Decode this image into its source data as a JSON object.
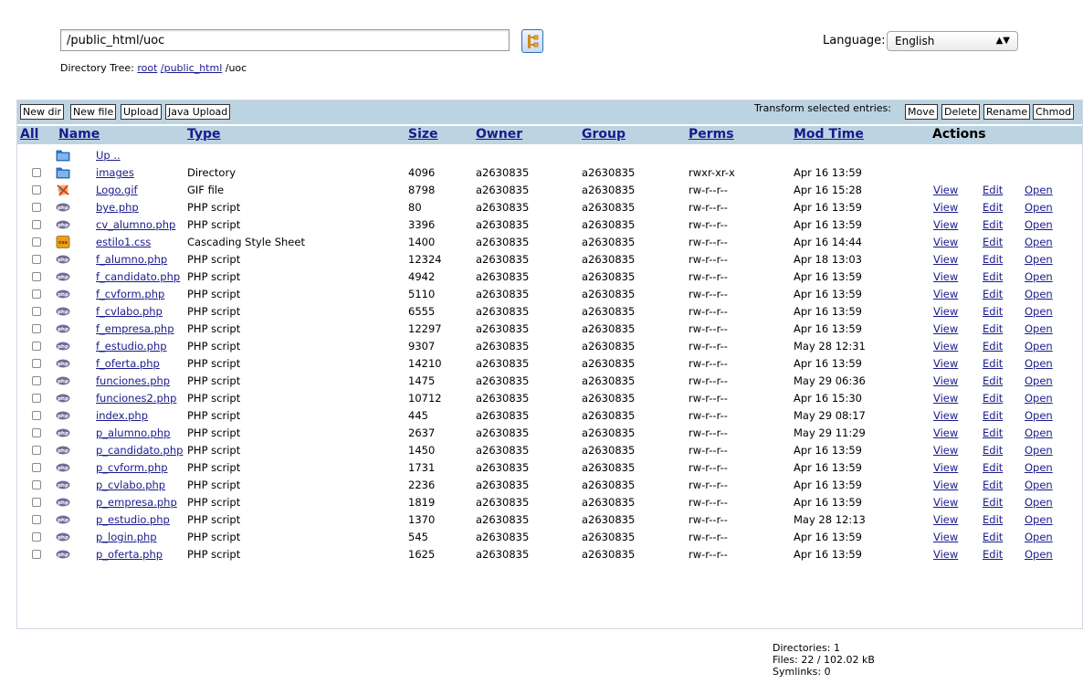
{
  "path": {
    "value": "/public_html/uoc"
  },
  "tree": {
    "label": "Directory Tree:",
    "root": "root",
    "seg1": "/public_html",
    "seg2": " /uoc"
  },
  "language": {
    "label": "Language:",
    "selected": "English"
  },
  "toolbar": {
    "new_dir": "New dir",
    "new_file": "New file",
    "upload": "Upload",
    "java_upload": "Java Upload",
    "transform_label": "Transform selected entries:",
    "move": "Move",
    "delete": "Delete",
    "rename": "Rename",
    "chmod": "Chmod"
  },
  "headers": {
    "all": "All",
    "name": "Name",
    "type": "Type",
    "size": "Size",
    "owner": "Owner",
    "group": "Group",
    "perms": "Perms",
    "mod_time": "Mod Time",
    "actions": "Actions"
  },
  "actions": {
    "view": "View",
    "edit": "Edit",
    "open": "Open"
  },
  "up_label": "Up ..",
  "rows": [
    {
      "icon": "folder-icon",
      "name": "images",
      "type": "Directory",
      "size": "4096",
      "owner": "a2630835",
      "group": "a2630835",
      "perms": "rwxr-xr-x",
      "mod": "Apr 16 13:59",
      "actions": false
    },
    {
      "icon": "image-file-icon",
      "name": "Logo.gif",
      "type": "GIF file",
      "size": "8798",
      "owner": "a2630835",
      "group": "a2630835",
      "perms": "rw-r--r--",
      "mod": "Apr 16 15:28",
      "actions": true
    },
    {
      "icon": "php-file-icon",
      "name": "bye.php",
      "type": "PHP script",
      "size": "80",
      "owner": "a2630835",
      "group": "a2630835",
      "perms": "rw-r--r--",
      "mod": "Apr 16 13:59",
      "actions": true
    },
    {
      "icon": "php-file-icon",
      "name": "cv_alumno.php",
      "type": "PHP script",
      "size": "3396",
      "owner": "a2630835",
      "group": "a2630835",
      "perms": "rw-r--r--",
      "mod": "Apr 16 13:59",
      "actions": true
    },
    {
      "icon": "css-file-icon",
      "name": "estilo1.css",
      "type": "Cascading Style Sheet",
      "size": "1400",
      "owner": "a2630835",
      "group": "a2630835",
      "perms": "rw-r--r--",
      "mod": "Apr 16 14:44",
      "actions": true
    },
    {
      "icon": "php-file-icon",
      "name": "f_alumno.php",
      "type": "PHP script",
      "size": "12324",
      "owner": "a2630835",
      "group": "a2630835",
      "perms": "rw-r--r--",
      "mod": "Apr 18 13:03",
      "actions": true
    },
    {
      "icon": "php-file-icon",
      "name": "f_candidato.php",
      "type": "PHP script",
      "size": "4942",
      "owner": "a2630835",
      "group": "a2630835",
      "perms": "rw-r--r--",
      "mod": "Apr 16 13:59",
      "actions": true
    },
    {
      "icon": "php-file-icon",
      "name": "f_cvform.php",
      "type": "PHP script",
      "size": "5110",
      "owner": "a2630835",
      "group": "a2630835",
      "perms": "rw-r--r--",
      "mod": "Apr 16 13:59",
      "actions": true
    },
    {
      "icon": "php-file-icon",
      "name": "f_cvlabo.php",
      "type": "PHP script",
      "size": "6555",
      "owner": "a2630835",
      "group": "a2630835",
      "perms": "rw-r--r--",
      "mod": "Apr 16 13:59",
      "actions": true
    },
    {
      "icon": "php-file-icon",
      "name": "f_empresa.php",
      "type": "PHP script",
      "size": "12297",
      "owner": "a2630835",
      "group": "a2630835",
      "perms": "rw-r--r--",
      "mod": "Apr 16 13:59",
      "actions": true
    },
    {
      "icon": "php-file-icon",
      "name": "f_estudio.php",
      "type": "PHP script",
      "size": "9307",
      "owner": "a2630835",
      "group": "a2630835",
      "perms": "rw-r--r--",
      "mod": "May 28 12:31",
      "actions": true
    },
    {
      "icon": "php-file-icon",
      "name": "f_oferta.php",
      "type": "PHP script",
      "size": "14210",
      "owner": "a2630835",
      "group": "a2630835",
      "perms": "rw-r--r--",
      "mod": "Apr 16 13:59",
      "actions": true
    },
    {
      "icon": "php-file-icon",
      "name": "funciones.php",
      "type": "PHP script",
      "size": "1475",
      "owner": "a2630835",
      "group": "a2630835",
      "perms": "rw-r--r--",
      "mod": "May 29 06:36",
      "actions": true
    },
    {
      "icon": "php-file-icon",
      "name": "funciones2.php",
      "type": "PHP script",
      "size": "10712",
      "owner": "a2630835",
      "group": "a2630835",
      "perms": "rw-r--r--",
      "mod": "Apr 16 15:30",
      "actions": true
    },
    {
      "icon": "php-file-icon",
      "name": "index.php",
      "type": "PHP script",
      "size": "445",
      "owner": "a2630835",
      "group": "a2630835",
      "perms": "rw-r--r--",
      "mod": "May 29 08:17",
      "actions": true
    },
    {
      "icon": "php-file-icon",
      "name": "p_alumno.php",
      "type": "PHP script",
      "size": "2637",
      "owner": "a2630835",
      "group": "a2630835",
      "perms": "rw-r--r--",
      "mod": "May 29 11:29",
      "actions": true
    },
    {
      "icon": "php-file-icon",
      "name": "p_candidato.php",
      "type": "PHP script",
      "size": "1450",
      "owner": "a2630835",
      "group": "a2630835",
      "perms": "rw-r--r--",
      "mod": "Apr 16 13:59",
      "actions": true
    },
    {
      "icon": "php-file-icon",
      "name": "p_cvform.php",
      "type": "PHP script",
      "size": "1731",
      "owner": "a2630835",
      "group": "a2630835",
      "perms": "rw-r--r--",
      "mod": "Apr 16 13:59",
      "actions": true
    },
    {
      "icon": "php-file-icon",
      "name": "p_cvlabo.php",
      "type": "PHP script",
      "size": "2236",
      "owner": "a2630835",
      "group": "a2630835",
      "perms": "rw-r--r--",
      "mod": "Apr 16 13:59",
      "actions": true
    },
    {
      "icon": "php-file-icon",
      "name": "p_empresa.php",
      "type": "PHP script",
      "size": "1819",
      "owner": "a2630835",
      "group": "a2630835",
      "perms": "rw-r--r--",
      "mod": "Apr 16 13:59",
      "actions": true
    },
    {
      "icon": "php-file-icon",
      "name": "p_estudio.php",
      "type": "PHP script",
      "size": "1370",
      "owner": "a2630835",
      "group": "a2630835",
      "perms": "rw-r--r--",
      "mod": "May 28 12:13",
      "actions": true
    },
    {
      "icon": "php-file-icon",
      "name": "p_login.php",
      "type": "PHP script",
      "size": "545",
      "owner": "a2630835",
      "group": "a2630835",
      "perms": "rw-r--r--",
      "mod": "Apr 16 13:59",
      "actions": true
    },
    {
      "icon": "php-file-icon",
      "name": "p_oferta.php",
      "type": "PHP script",
      "size": "1625",
      "owner": "a2630835",
      "group": "a2630835",
      "perms": "rw-r--r--",
      "mod": "Apr 16 13:59",
      "actions": true
    }
  ],
  "stats": {
    "directories": "Directories: 1",
    "files": "Files: 22 / 102.02 kB",
    "symlinks": "Symlinks: 0"
  }
}
